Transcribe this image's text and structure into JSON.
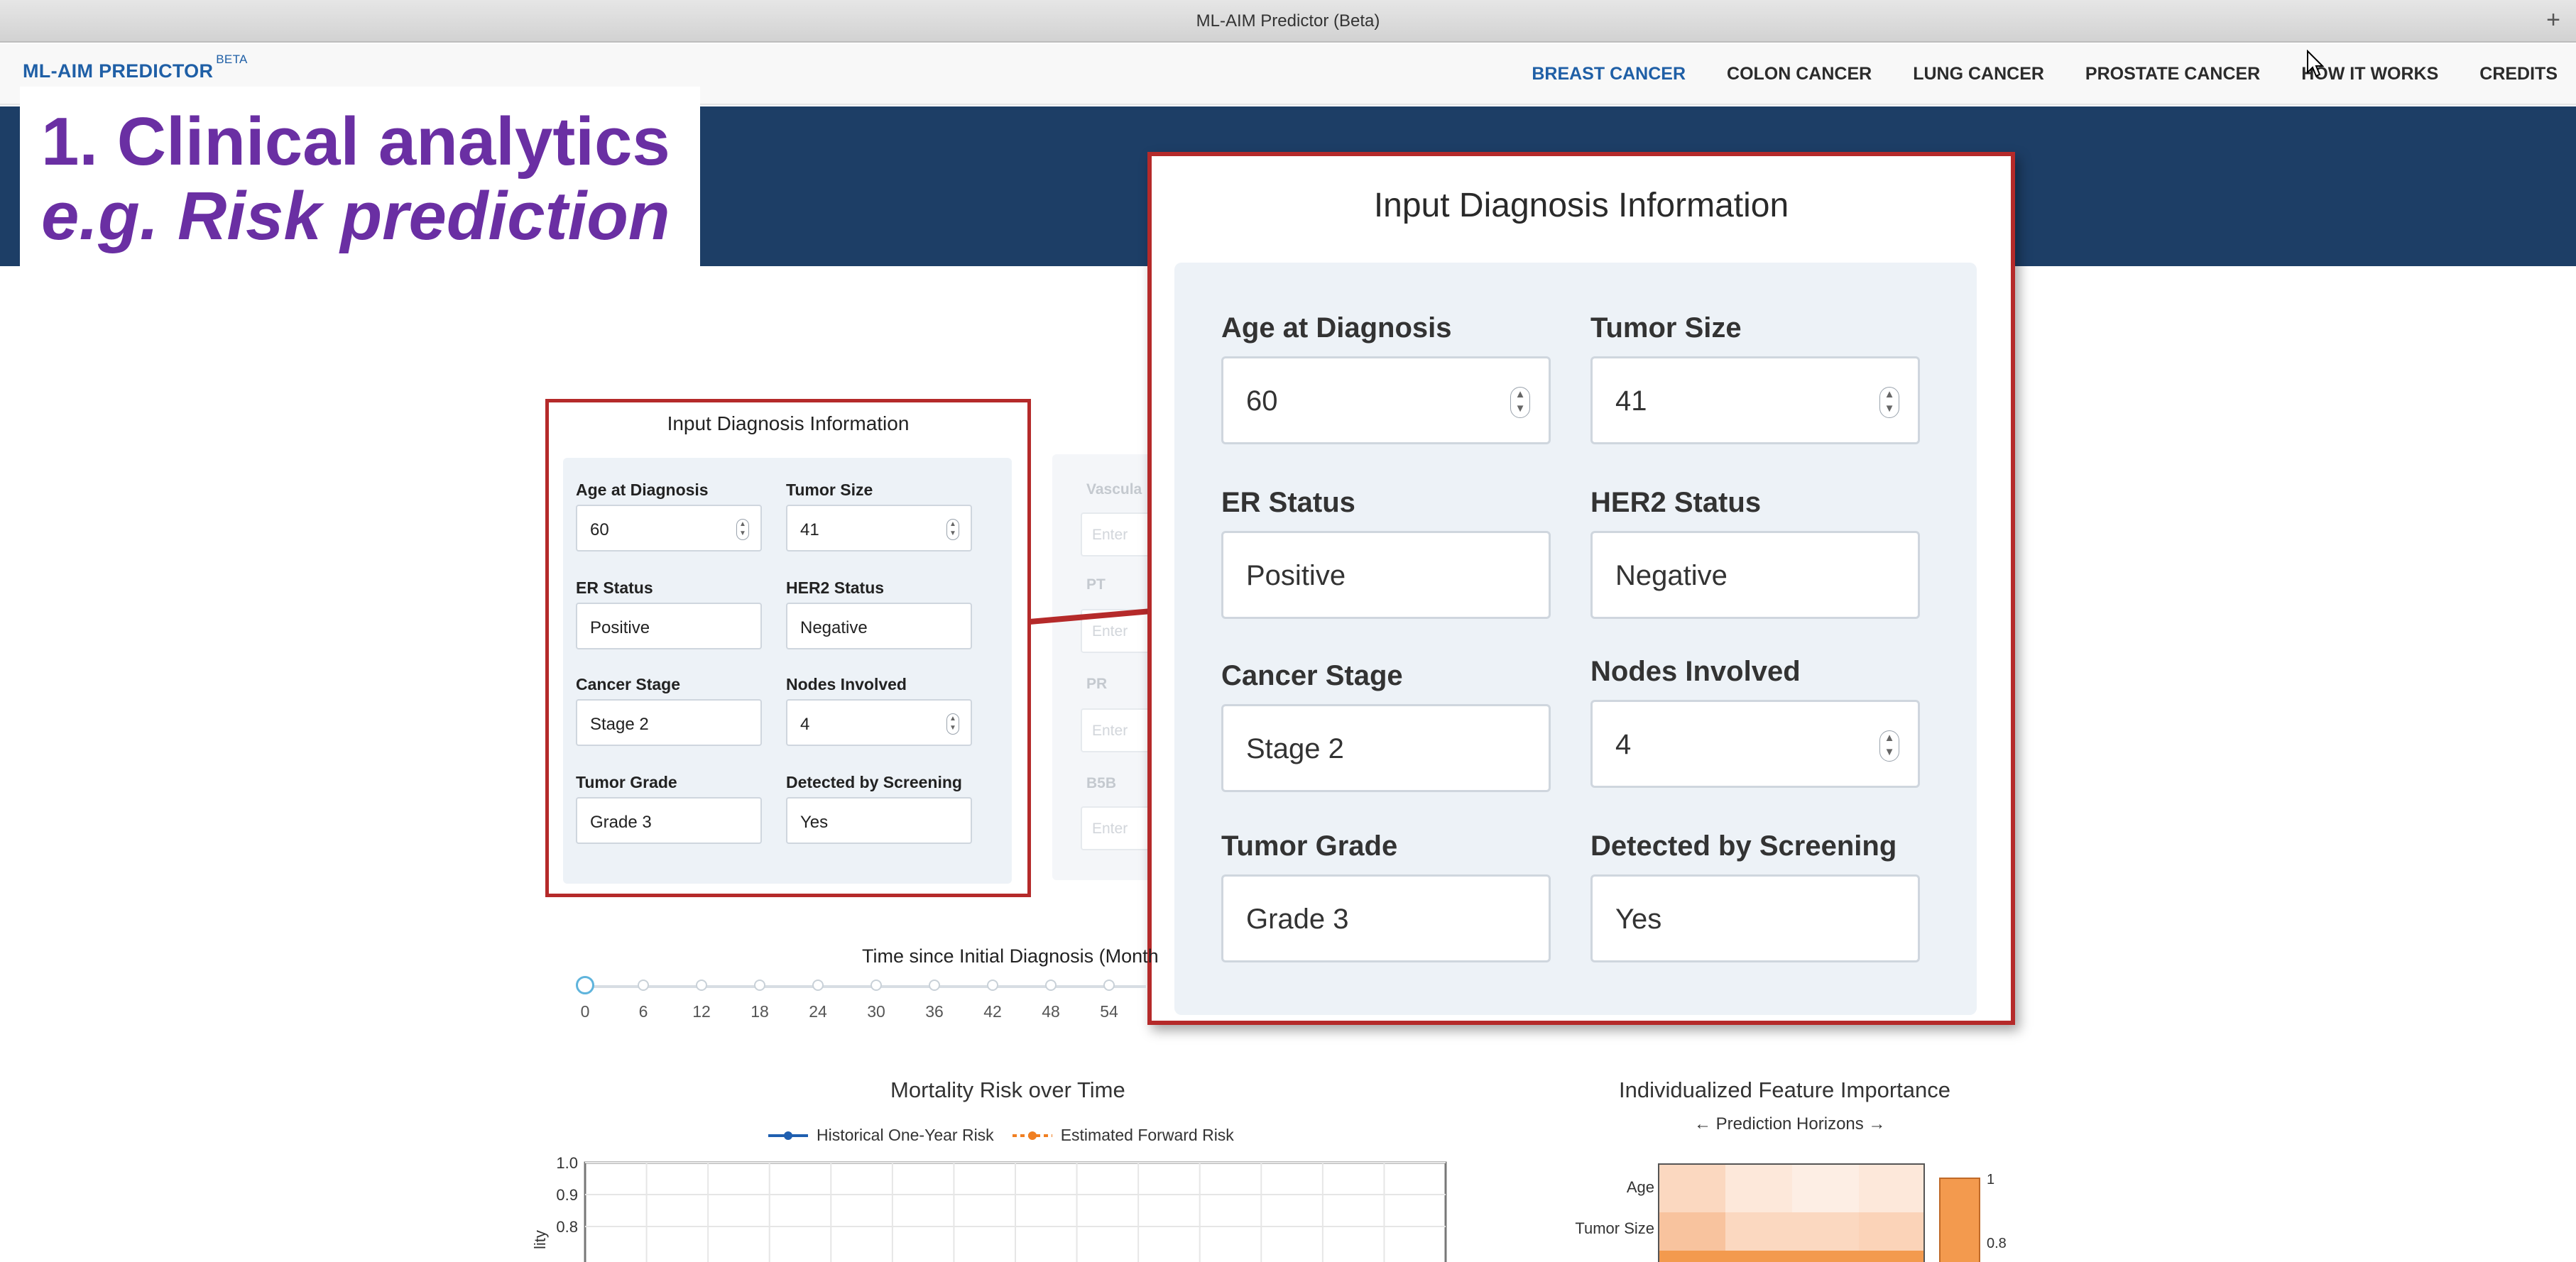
{
  "window": {
    "title": "ML-AIM Predictor (Beta)",
    "new_tab_symbol": "+"
  },
  "nav": {
    "brand": "ML-AIM PREDICTOR",
    "brand_badge": "BETA",
    "links": [
      "BREAST CANCER",
      "COLON CANCER",
      "LUNG CANCER",
      "PROSTATE CANCER",
      "HOW IT WORKS",
      "CREDITS"
    ],
    "active_link": "BREAST CANCER"
  },
  "annotation": {
    "line1": "1. Clinical analytics",
    "line2": "e.g. Risk prediction"
  },
  "form": {
    "title": "Input Diagnosis Information",
    "fields": [
      {
        "label": "Age at Diagnosis",
        "value": "60",
        "numeric": true
      },
      {
        "label": "Tumor Size",
        "value": "41",
        "numeric": true
      },
      {
        "label": "ER Status",
        "value": "Positive",
        "numeric": false
      },
      {
        "label": "HER2 Status",
        "value": "Negative",
        "numeric": false
      },
      {
        "label": "Cancer Stage",
        "value": "Stage 2",
        "numeric": false
      },
      {
        "label": "Nodes Involved",
        "value": "4",
        "numeric": true
      },
      {
        "label": "Tumor Grade",
        "value": "Grade 3",
        "numeric": false
      },
      {
        "label": "Detected by Screening",
        "value": "Yes",
        "numeric": false
      }
    ]
  },
  "faded_column": {
    "labels": [
      "Vascula",
      "PT",
      "PR",
      "B5B"
    ],
    "placeholder": "Enter"
  },
  "slider": {
    "title": "Time since Initial Diagnosis (Month",
    "ticks": [
      "0",
      "6",
      "12",
      "18",
      "24",
      "30",
      "36",
      "42",
      "48",
      "54"
    ],
    "selected": "0"
  },
  "mortality_chart": {
    "title": "Mortality Risk over Time",
    "legend": [
      "Historical One-Year Risk",
      "Estimated Forward Risk"
    ],
    "ylabel_fragment": "lity",
    "colors": {
      "historical": "#1f5fb0",
      "forward": "#f07f22"
    }
  },
  "feature_importance": {
    "title": "Individualized Feature Importance",
    "subtitle": "← Prediction Horizons →",
    "colorbar_labels": [
      "1",
      "0.8"
    ],
    "colors": {
      "low": "#fde8da",
      "high": "#f39a4e"
    }
  },
  "chart_data": {
    "type": "line",
    "title": "Mortality Risk over Time",
    "series": [
      {
        "name": "Historical One-Year Risk",
        "values": []
      },
      {
        "name": "Estimated Forward Risk",
        "values": []
      }
    ],
    "ylim": [
      0.7,
      1.0
    ],
    "yticks": [
      "1.0",
      "0.9",
      "0.8"
    ],
    "grid": true,
    "legend_position": "top"
  }
}
